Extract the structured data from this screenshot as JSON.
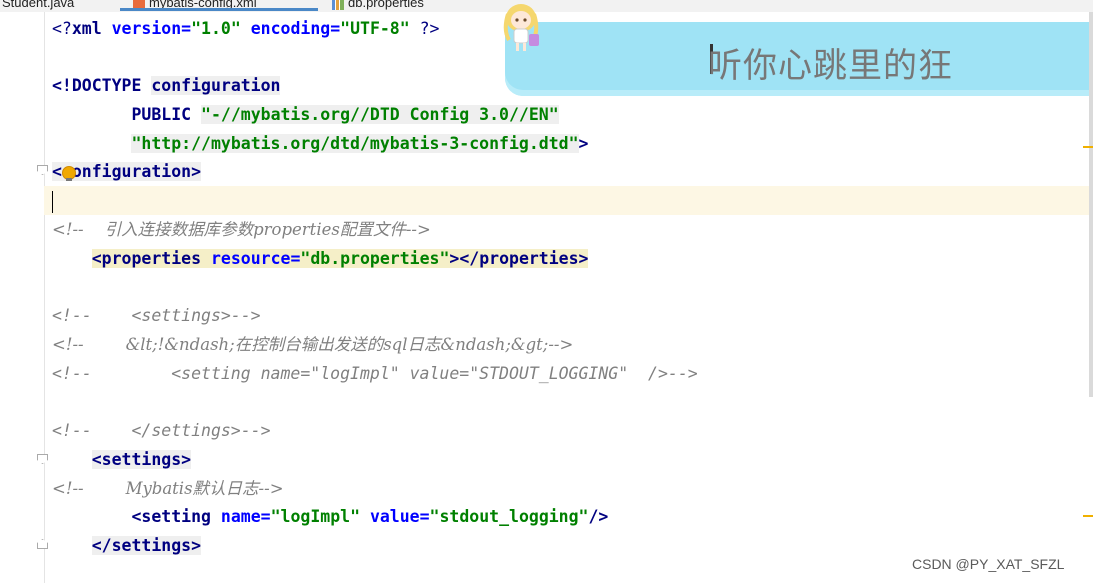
{
  "tabs": [
    {
      "label": "Student.java",
      "icon": "java-file-icon"
    },
    {
      "label": "mybatis-config.xml",
      "icon": "xml-file-icon",
      "active": true
    },
    {
      "label": "db.properties",
      "icon": "properties-file-icon"
    }
  ],
  "editor": {
    "line1": {
      "open": "<?",
      "name": "xml",
      "a1": "version",
      "v1": "\"1.0\"",
      "a2": "encoding",
      "v2": "\"UTF-8\"",
      "close": " ?>"
    },
    "line3": {
      "doctype": "<!DOCTYPE",
      "root": "configuration"
    },
    "line4": {
      "public": "PUBLIC",
      "id": "\"-//mybatis.org//DTD Config 3.0//EN\""
    },
    "line5": {
      "dtd": "\"http://mybatis.org/dtd/mybatis-3-config.dtd\"",
      "close": ">"
    },
    "line6": {
      "tag": "<configuration>"
    },
    "line8": {
      "comment": "<!--    引入连接数据库参数properties配置文件-->"
    },
    "line9": {
      "open": "<properties",
      "attr": "resource",
      "val": "\"db.properties\"",
      "close": "></properties>"
    },
    "line11": {
      "comment": "<!--    <settings>-->"
    },
    "line12": {
      "comment": "<!--        &lt;!&ndash;在控制台输出发送的sql日志&ndash;&gt;-->"
    },
    "line13": {
      "comment": "<!--        <setting name=\"logImpl\" value=\"STDOUT_LOGGING\"  />-->"
    },
    "line15": {
      "comment": "<!--    </settings>-->"
    },
    "line16": {
      "tag": "<settings>"
    },
    "line17": {
      "comment": "<!--        Mybatis默认日志-->"
    },
    "line18": {
      "open": "<setting",
      "a1": "name",
      "v1": "\"logImpl\"",
      "a2": "value",
      "v2": "\"stdout_logging\"",
      "close": "/>"
    },
    "line19": {
      "tag": "</settings>"
    }
  },
  "banner": {
    "text": "听你心跳里的狂"
  },
  "watermark": "CSDN @PY_XAT_SFZL",
  "colors": {
    "tag": "#000080",
    "attr": "#0000ff",
    "string": "#008000",
    "comment": "#808080",
    "banner": "#9fe3f5"
  }
}
